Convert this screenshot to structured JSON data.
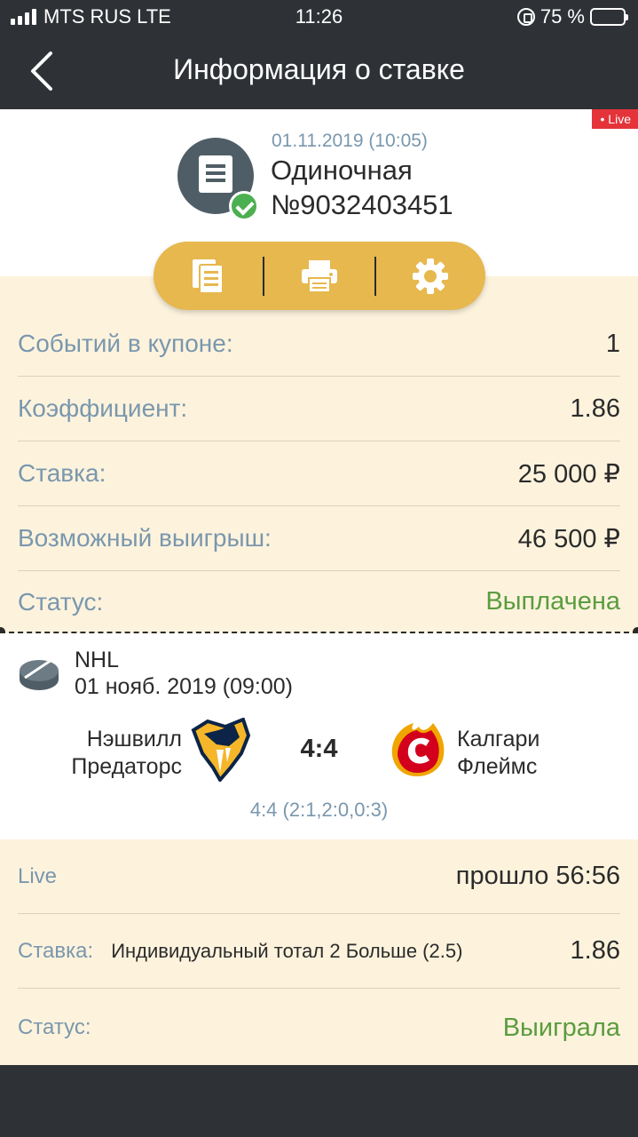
{
  "status_bar": {
    "carrier": "MTS RUS LTE",
    "time": "11:26",
    "battery_percent": "75 %",
    "battery_level": 0.75
  },
  "nav": {
    "title": "Информация о ставке",
    "back_icon": "chevron-left-icon"
  },
  "header": {
    "live_badge": "• Live",
    "date": "01.11.2019 (10:05)",
    "type": "Одиночная",
    "number": "№9032403451"
  },
  "actions": [
    {
      "icon": "document-icon"
    },
    {
      "icon": "printer-icon"
    },
    {
      "icon": "gear-icon"
    }
  ],
  "summary": {
    "events_label": "Событий в купоне:",
    "events_value": "1",
    "coef_label": "Коэффициент:",
    "coef_value": "1.86",
    "stake_label": "Ставка:",
    "stake_value": "25 000 ₽",
    "win_label": "Возможный выигрыш:",
    "win_value": "46 500 ₽",
    "status_label": "Статус:",
    "status_value": "Выплачена"
  },
  "match": {
    "league": "NHL",
    "date": "01 нояб. 2019 (09:00)",
    "home_line1": "Нэшвилл",
    "home_line2": "Предаторс",
    "away_line1": "Калгари",
    "away_line2": "Флеймс",
    "score": "4:4",
    "periods": "4:4 (2:1,2:0,0:3)"
  },
  "detail": {
    "live_label": "Live",
    "elapsed": "прошло 56:56",
    "bet_label": "Ставка:",
    "bet_text": "Индивидуальный тотал 2 Больше (2.5)",
    "bet_coef": "1.86",
    "status_label": "Статус:",
    "status_value": "Выиграла"
  },
  "colors": {
    "accent_gold": "#e6b84e",
    "panel_cream": "#fdf3dd",
    "label_blue_gray": "#7a97ad",
    "status_green": "#5b9c3f",
    "live_red": "#e5333a",
    "dark_bar": "#2e3236"
  }
}
